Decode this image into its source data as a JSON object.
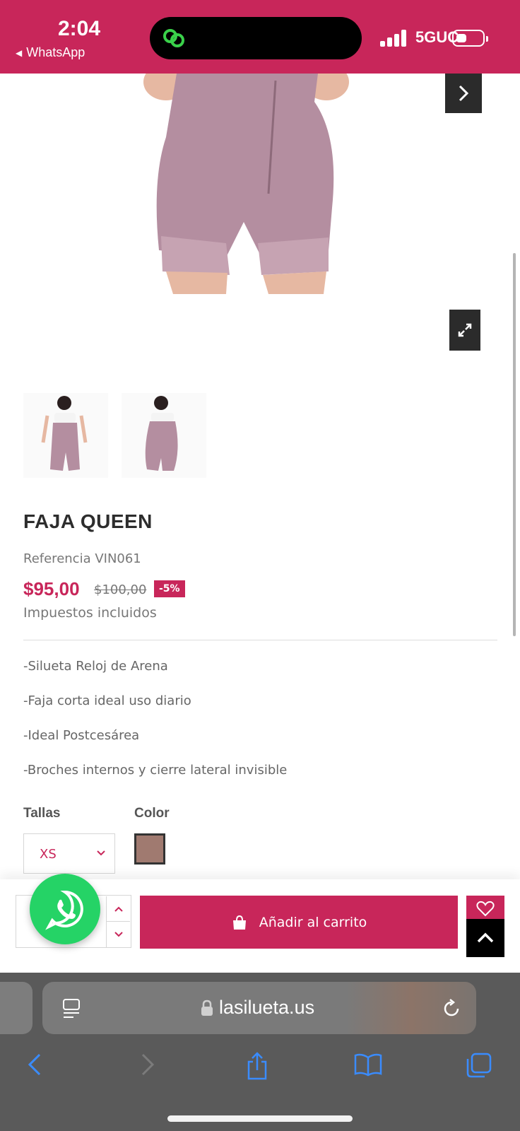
{
  "status_bar": {
    "time": "2:04",
    "back_app": "WhatsApp",
    "network": "5GUC",
    "background_color": "#c8265a"
  },
  "product": {
    "title": "FAJA QUEEN",
    "reference": "Referencia VIN061",
    "price": "$95,00",
    "old_price": "$100,00",
    "discount": "-5%",
    "taxes_note": "Impuestos incluidos",
    "features": [
      "-Silueta Reloj de Arena",
      "-Faja corta ideal uso diario",
      "-Ideal Postcesárea",
      "-Broches internos y cierre lateral invisible"
    ],
    "size_label": "Tallas",
    "size_value": "XS",
    "color_label": "Color",
    "color_swatch": "#a07a70",
    "accent_color": "#c8265a",
    "thumbnails": [
      "product-front-thumbnail",
      "product-back-thumbnail"
    ]
  },
  "cart_bar": {
    "add_to_cart_label": "Añadir al carrito"
  },
  "browser": {
    "url": "lasilueta.us",
    "icons": [
      "reader-icon",
      "lock-icon",
      "reload-icon",
      "back-icon",
      "forward-icon",
      "share-icon",
      "bookmarks-icon",
      "tabs-icon"
    ]
  }
}
